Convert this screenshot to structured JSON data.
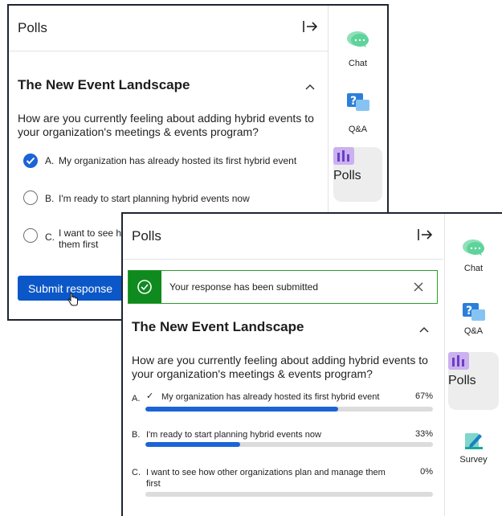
{
  "back_panel": {
    "header": {
      "title": "Polls"
    },
    "poll": {
      "title": "The New Event Landscape",
      "question": "How are you currently feeling about adding hybrid events to your organization's meetings & events program?",
      "options": [
        {
          "letter": "A.",
          "text": "My organization has already hosted its first hybrid event",
          "selected": true
        },
        {
          "letter": "B.",
          "text": "I'm ready to start planning hybrid events now",
          "selected": false
        },
        {
          "letter": "C.",
          "text_line1": "I want to see h",
          "text_line2": "them first",
          "selected": false
        }
      ],
      "submit_label": "Submit response"
    },
    "rail": [
      {
        "label": "Chat",
        "icon": "chat-icon"
      },
      {
        "label": "Q&A",
        "icon": "qa-icon"
      },
      {
        "label": "Polls",
        "icon": "polls-icon",
        "active": true
      }
    ]
  },
  "front_panel": {
    "header": {
      "title": "Polls"
    },
    "alert": {
      "message": "Your response has been submitted"
    },
    "poll": {
      "title": "The New Event Landscape",
      "question": "How are you currently feeling about adding hybrid events to your organization's meetings & events program?",
      "results": [
        {
          "letter": "A.",
          "check": "✓",
          "text": "My organization has already hosted its first hybrid event",
          "percent_label": "67%",
          "percent": 67
        },
        {
          "letter": "B.",
          "text": "I'm ready to start planning hybrid events now",
          "percent_label": "33%",
          "percent": 33
        },
        {
          "letter": "C.",
          "text_line1": "I want to see how other organizations plan and manage them",
          "text_line2": "first",
          "percent_label": "0%",
          "percent": 0
        }
      ]
    },
    "rail": [
      {
        "label": "Chat",
        "icon": "chat-icon"
      },
      {
        "label": "Q&A",
        "icon": "qa-icon"
      },
      {
        "label": "Polls",
        "icon": "polls-icon",
        "active": true
      },
      {
        "label": "Survey",
        "icon": "survey-icon"
      }
    ]
  },
  "colors": {
    "primary": "#0b57c8",
    "progress": "#1b64d6",
    "success": "#0f8a1e",
    "chat_icon": "#5ed39b",
    "qa_icon": "#2b7fd8",
    "polls_icon": "#b99be6",
    "survey_icon": "#1aa79a"
  }
}
